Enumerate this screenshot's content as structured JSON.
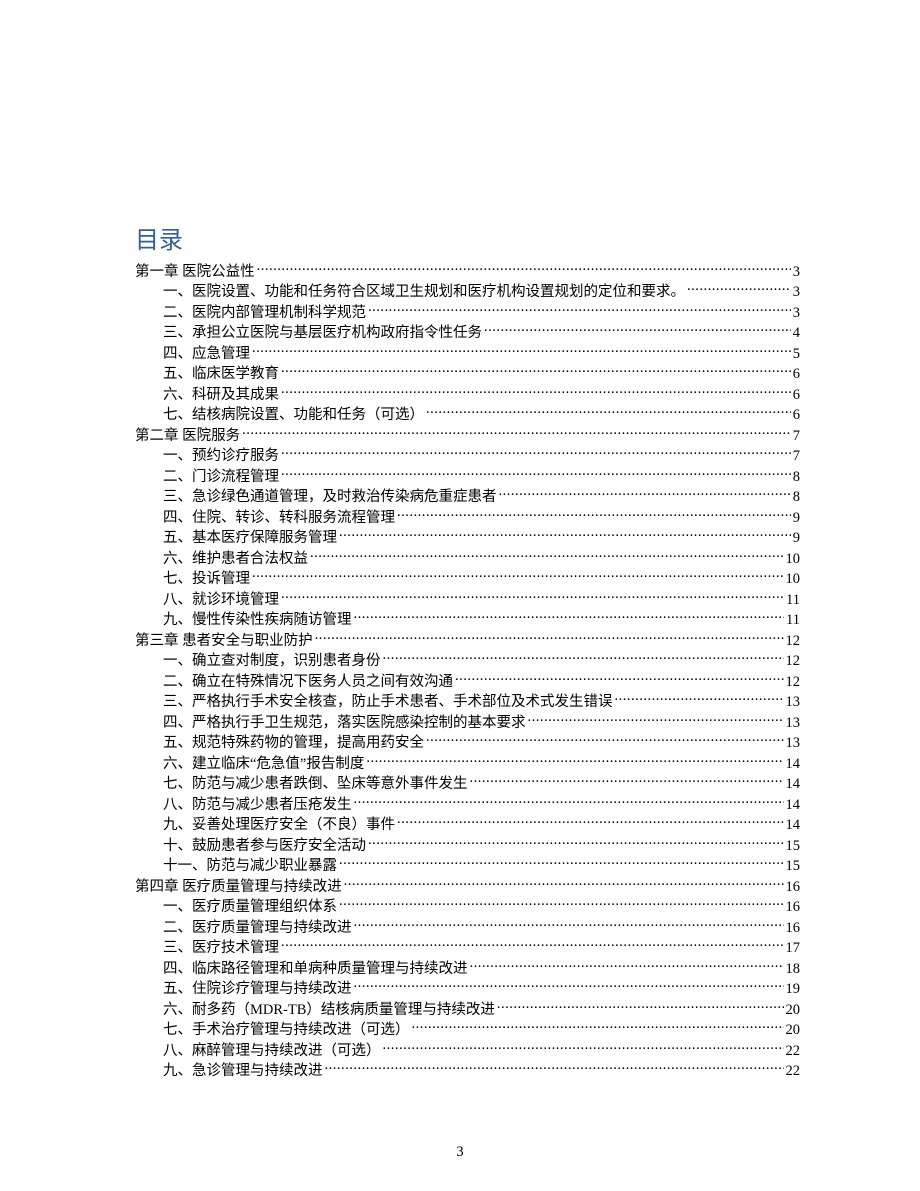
{
  "title": "目录",
  "page_number": "3",
  "entries": [
    {
      "indent": 0,
      "text": "第一章  医院公益性",
      "page": "3"
    },
    {
      "indent": 1,
      "text": "一、医院设置、功能和任务符合区域卫生规划和医疗机构设置规划的定位和要求。 ",
      "page": "3"
    },
    {
      "indent": 1,
      "text": "二、医院内部管理机制科学规范",
      "page": "3"
    },
    {
      "indent": 1,
      "text": "三、承担公立医院与基层医疗机构政府指令性任务",
      "page": "4"
    },
    {
      "indent": 1,
      "text": "四、应急管理",
      "page": "5"
    },
    {
      "indent": 1,
      "text": "五、临床医学教育",
      "page": "6"
    },
    {
      "indent": 1,
      "text": "六、科研及其成果",
      "page": "6"
    },
    {
      "indent": 1,
      "text": "七、结核病院设置、功能和任务（可选）",
      "page": "6"
    },
    {
      "indent": 0,
      "text": "第二章  医院服务",
      "page": "7"
    },
    {
      "indent": 1,
      "text": "一、预约诊疗服务",
      "page": "7"
    },
    {
      "indent": 1,
      "text": "二、门诊流程管理",
      "page": "8"
    },
    {
      "indent": 1,
      "text": "三、急诊绿色通道管理，及时救治传染病危重症患者",
      "page": "8"
    },
    {
      "indent": 1,
      "text": "四、住院、转诊、转科服务流程管理",
      "page": "9"
    },
    {
      "indent": 1,
      "text": "五、基本医疗保障服务管理",
      "page": "9"
    },
    {
      "indent": 1,
      "text": "六、维护患者合法权益",
      "page": "10"
    },
    {
      "indent": 1,
      "text": "七、投诉管理",
      "page": "10"
    },
    {
      "indent": 1,
      "text": "八、就诊环境管理",
      "page": "11"
    },
    {
      "indent": 1,
      "text": "九、慢性传染性疾病随访管理",
      "page": "11"
    },
    {
      "indent": 0,
      "text": "第三章  患者安全与职业防护",
      "page": "12"
    },
    {
      "indent": 1,
      "text": "一、确立查对制度，识别患者身份",
      "page": "12"
    },
    {
      "indent": 1,
      "text": "二、确立在特殊情况下医务人员之间有效沟通",
      "page": "12"
    },
    {
      "indent": 1,
      "text": "三、严格执行手术安全核查，防止手术患者、手术部位及术式发生错误",
      "page": "13"
    },
    {
      "indent": 1,
      "text": "四、严格执行手卫生规范，落实医院感染控制的基本要求",
      "page": "13"
    },
    {
      "indent": 1,
      "text": "五、规范特殊药物的管理，提高用药安全",
      "page": "13"
    },
    {
      "indent": 1,
      "text": "六、建立临床“危急值”报告制度",
      "page": "14"
    },
    {
      "indent": 1,
      "text": "七、防范与减少患者跌倒、坠床等意外事件发生",
      "page": "14"
    },
    {
      "indent": 1,
      "text": "八、防范与减少患者压疮发生",
      "page": "14"
    },
    {
      "indent": 1,
      "text": "九、妥善处理医疗安全（不良）事件",
      "page": "14"
    },
    {
      "indent": 1,
      "text": "十、鼓励患者参与医疗安全活动",
      "page": "15"
    },
    {
      "indent": 1,
      "text": "十一、防范与减少职业暴露",
      "page": "15"
    },
    {
      "indent": 0,
      "text": "第四章  医疗质量管理与持续改进",
      "page": "16"
    },
    {
      "indent": 1,
      "text": "一、医疗质量管理组织体系",
      "page": "16"
    },
    {
      "indent": 1,
      "text": "二、医疗质量管理与持续改进",
      "page": "16"
    },
    {
      "indent": 1,
      "text": "三、医疗技术管理",
      "page": "17"
    },
    {
      "indent": 1,
      "text": "四、临床路径管理和单病种质量管理与持续改进",
      "page": "18"
    },
    {
      "indent": 1,
      "text": "五、住院诊疗管理与持续改进",
      "page": "19"
    },
    {
      "indent": 1,
      "text": "六、耐多药（MDR-TB）结核病质量管理与持续改进",
      "page": "20"
    },
    {
      "indent": 1,
      "text": "七、手术治疗管理与持续改进（可选） ",
      "page": "20"
    },
    {
      "indent": 1,
      "text": "八、麻醉管理与持续改进（可选） ",
      "page": "22"
    },
    {
      "indent": 1,
      "text": "九、急诊管理与持续改进",
      "page": "22"
    }
  ]
}
